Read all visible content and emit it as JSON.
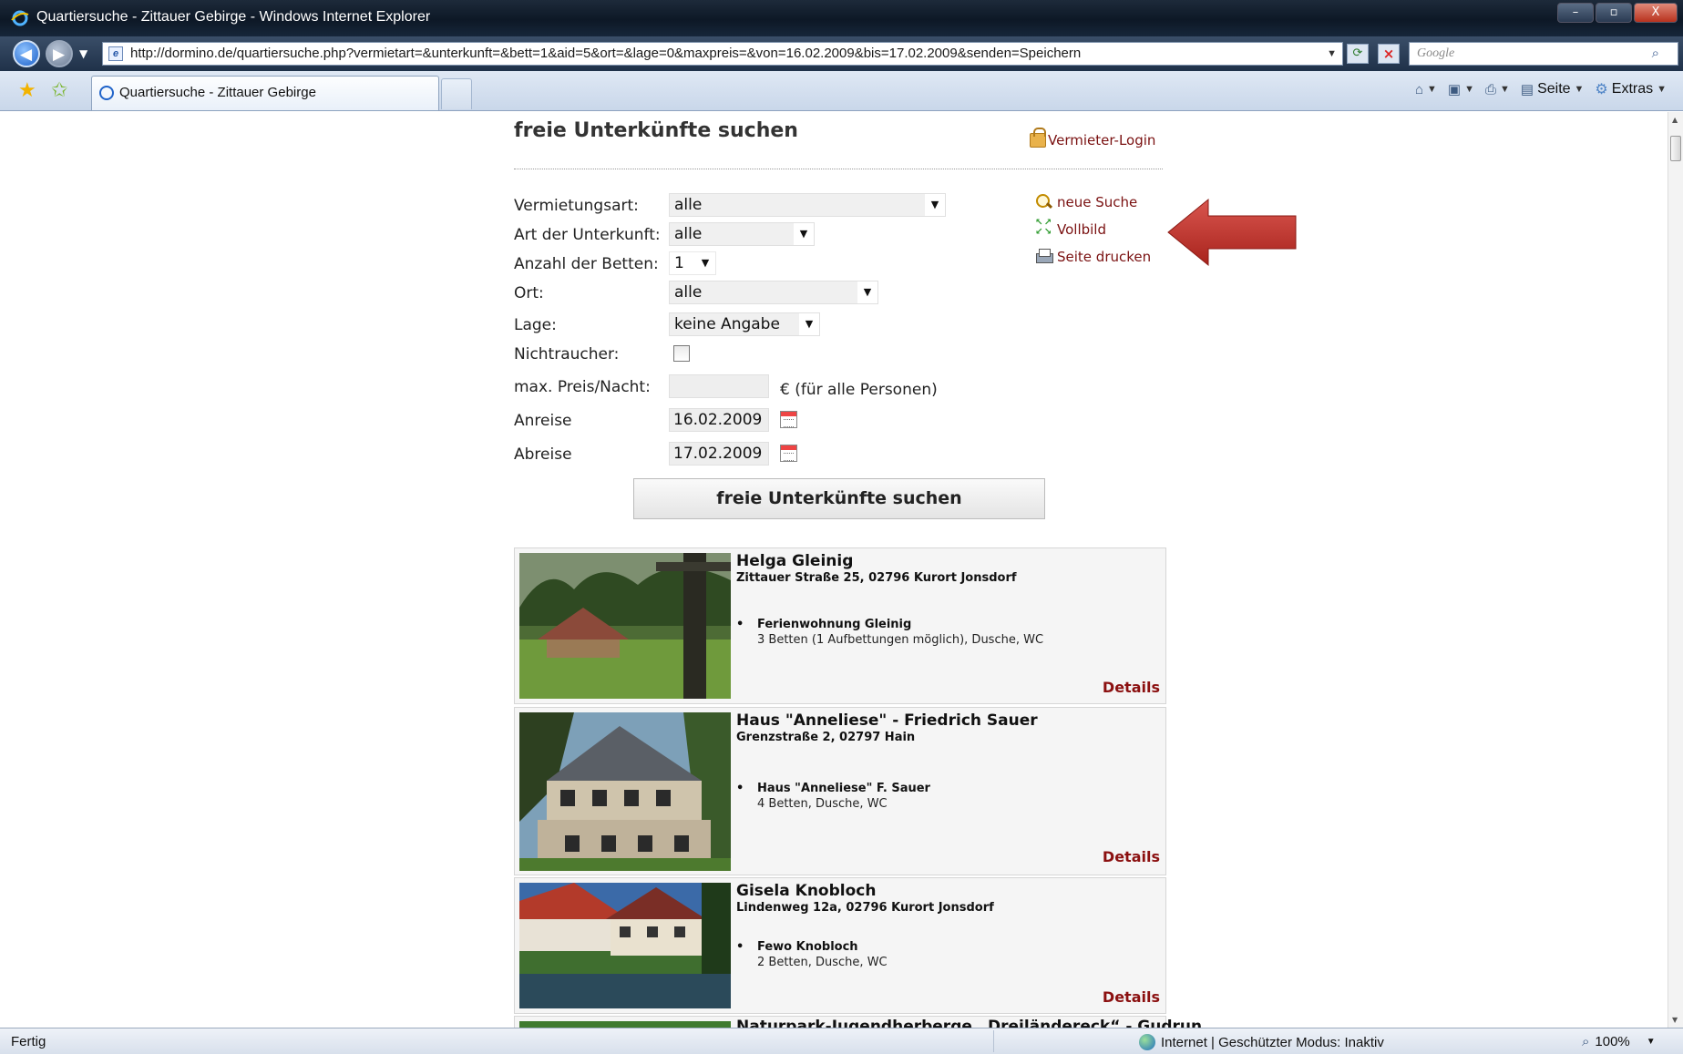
{
  "window": {
    "title": "Quartiersuche - Zittauer Gebirge - Windows Internet Explorer",
    "controls": {
      "minimize": "–",
      "maximize": "▫",
      "close": "X"
    }
  },
  "browser": {
    "url": "http://dormino.de/quartiersuche.php?vermietart=&unterkunft=&bett=1&aid=5&ort=&lage=0&maxpreis=&von=16.02.2009&bis=17.02.2009&senden=Speichern",
    "search_placeholder": "Google",
    "tab_title": "Quartiersuche - Zittauer Gebirge",
    "commands": {
      "page": "Seite",
      "tools": "Extras"
    }
  },
  "page": {
    "title": "freie Unterkünfte suchen",
    "landlord_login": "Vermieter-Login",
    "side_links": {
      "new_search": "neue Suche",
      "fullscreen": "Vollbild",
      "print": "Seite drucken"
    },
    "form": {
      "rental_type": {
        "label": "Vermietungsart:",
        "value": "alle"
      },
      "accommodation_type": {
        "label": "Art der Unterkunft:",
        "value": "alle"
      },
      "beds": {
        "label": "Anzahl der Betten:",
        "value": "1"
      },
      "place": {
        "label": "Ort:",
        "value": "alle"
      },
      "location": {
        "label": "Lage:",
        "value": "keine Angabe"
      },
      "non_smoker": {
        "label": "Nichtraucher:"
      },
      "max_price": {
        "label": "max. Preis/Nacht:",
        "value": "",
        "suffix": "€ (für alle Personen)"
      },
      "arrival": {
        "label": "Anreise",
        "value": "16.02.2009"
      },
      "departure": {
        "label": "Abreise",
        "value": "17.02.2009"
      },
      "submit": "freie Unterkünfte suchen"
    },
    "results": [
      {
        "name": "Helga Gleinig",
        "address": "Zittauer Straße 25, 02796 Kurort Jonsdorf",
        "unit": "Ferienwohnung Gleinig",
        "desc": "3 Betten (1 Aufbettungen möglich), Dusche, WC",
        "details": "Details",
        "bullet": "•"
      },
      {
        "name": "Haus \"Anneliese\" - Friedrich Sauer",
        "address": "Grenzstraße 2, 02797 Hain",
        "unit": "Haus \"Anneliese\" F. Sauer",
        "desc": "4 Betten, Dusche, WC",
        "details": "Details",
        "bullet": "•"
      },
      {
        "name": "Gisela Knobloch",
        "address": "Lindenweg 12a, 02796 Kurort Jonsdorf",
        "unit": "Fewo Knobloch",
        "desc": "2 Betten, Dusche, WC",
        "details": "Details",
        "bullet": "•"
      },
      {
        "name": "Naturpark-Jugendherberge „Dreiländereck“ - Gudrun"
      }
    ]
  },
  "status": {
    "left": "Fertig",
    "zone": "Internet | Geschützter Modus: Inaktiv",
    "zoom": "100%"
  }
}
